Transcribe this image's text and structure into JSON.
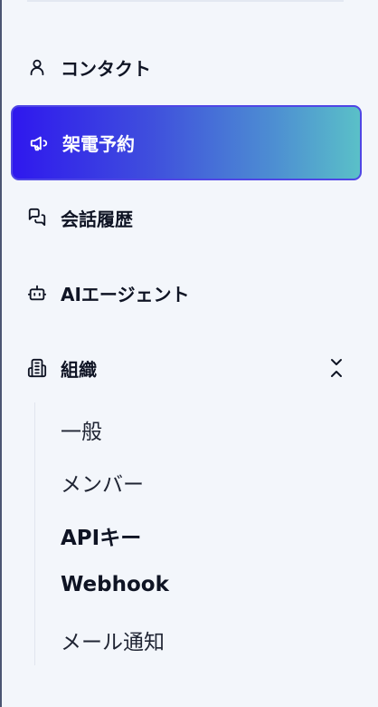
{
  "nav": {
    "contacts": "コンタクト",
    "call_booking": "架電予約",
    "history": "会話履歴",
    "agents": "AIエージェント",
    "organization": "組織"
  },
  "org_sub": {
    "general": "一般",
    "members": "メンバー",
    "api_keys": "APIキー",
    "webhook": "Webhook",
    "email_notify": "メール通知"
  },
  "colors": {
    "active_gradient_start": "#2f18ee",
    "active_gradient_end": "#5ac0c8",
    "active_border": "#4f46e5",
    "background": "#f3f6fb"
  },
  "icons": [
    "user-icon",
    "megaphone-icon",
    "chat-bubbles-icon",
    "robot-icon",
    "building-icon",
    "chevrons-collapse-icon"
  ]
}
